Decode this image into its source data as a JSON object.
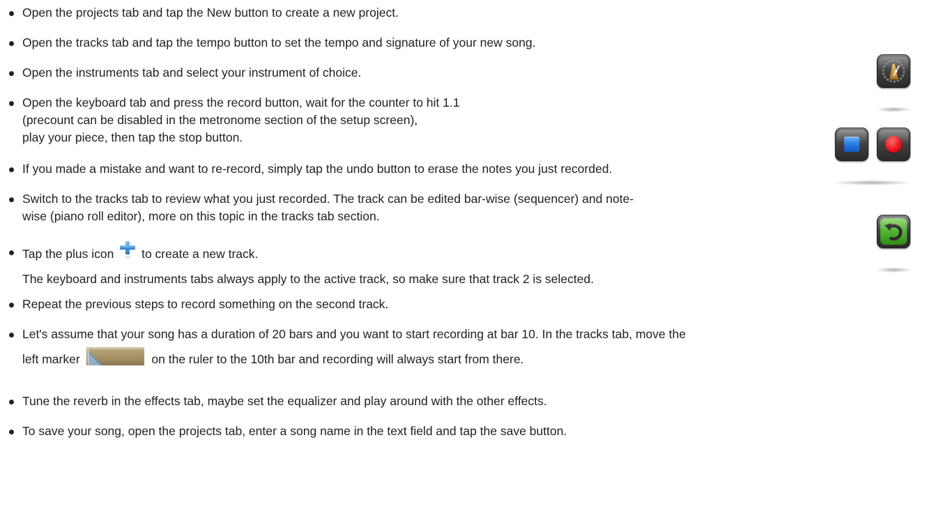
{
  "steps": [
    {
      "lines": [
        "Open the projects tab and tap the New button to create a new project."
      ]
    },
    {
      "lines": [
        "Open the tracks tab and tap the tempo button to set the tempo and signature of your new song."
      ]
    },
    {
      "lines": [
        "Open the instruments tab and select your instrument of choice."
      ]
    },
    {
      "lines": [
        "Open the keyboard tab and press the record button, wait for the counter to hit 1.1",
        "(precount can be disabled in the metronome section of the setup screen),",
        "play your piece, then tap the stop button."
      ]
    },
    {
      "lines": [
        "If you made a mistake and want to re-record, simply tap the undo button to erase the notes you just recorded."
      ]
    },
    {
      "lines": [
        "Switch to the tracks tab to review what you just recorded. The track can be edited bar-wise (sequencer) and note-",
        "wise (piano roll editor), more on this topic in the tracks tab section."
      ]
    },
    {
      "line1_before": "Tap the plus icon",
      "line1_after": "to create a new track.",
      "line2": "The keyboard and instruments tabs always apply to the active track, so make sure that track 2 is selected."
    },
    {
      "lines": [
        "Repeat the previous steps to record something on the second track."
      ]
    },
    {
      "line1": "Let's assume that your song has a duration of 20 bars and you want to start recording at bar 10. In the tracks tab, move the",
      "line2_before": "left marker",
      "line2_after": "on the ruler to the 10th bar and recording will always start from there."
    },
    {
      "lines": [
        "Tune the reverb in the effects tab, maybe set the equalizer and play around with the other effects."
      ]
    },
    {
      "lines": [
        "To save your song, open the projects tab, enter a song name in the text field and tap the save button."
      ]
    }
  ],
  "icons": {
    "tempo": "metronome-icon",
    "stop": "stop-icon",
    "record": "record-icon",
    "undo": "undo-arrow-icon",
    "plus": "plus-icon",
    "marker": "left-marker-icon"
  },
  "colors": {
    "text": "#222222",
    "record_red": "#e8141a",
    "stop_blue": "#1f74e0",
    "undo_green": "#4fb02e",
    "tempo_gold": "#c7963c",
    "plus_blue": "#3b8fd8",
    "marker_tan": "#a9966f"
  }
}
